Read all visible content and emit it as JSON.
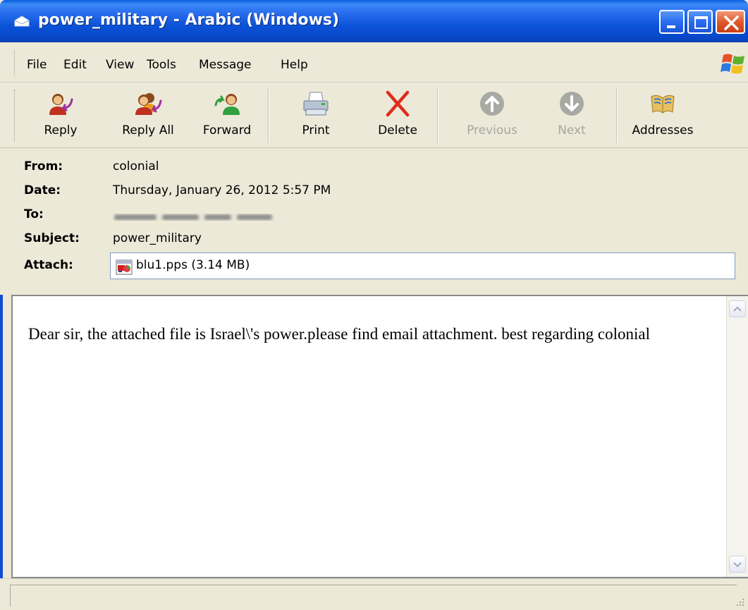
{
  "window": {
    "title": "power_military - Arabic (Windows)"
  },
  "menu": {
    "items": [
      "File",
      "Edit",
      "View",
      "Tools",
      "Message",
      "Help"
    ]
  },
  "toolbar": {
    "reply": "Reply",
    "reply_all": "Reply All",
    "forward": "Forward",
    "print": "Print",
    "delete": "Delete",
    "previous": "Previous",
    "next": "Next",
    "addresses": "Addresses"
  },
  "header": {
    "from_label": "From:",
    "from_value": "colonial",
    "date_label": "Date:",
    "date_value": "Thursday, January 26, 2012 5:57 PM",
    "to_label": "To:",
    "to_value": "",
    "subject_label": "Subject:",
    "subject_value": "power_military",
    "attach_label": "Attach:",
    "attach_value": "blu1.pps (3.14 MB)"
  },
  "body": {
    "text": "Dear sir, the attached file is Israel\\'s power.please find email attachment. best regarding colonial"
  },
  "colors": {
    "titlebar": "#0b53d8",
    "chrome": "#ece9d8",
    "delete_red": "#e02c1a"
  }
}
